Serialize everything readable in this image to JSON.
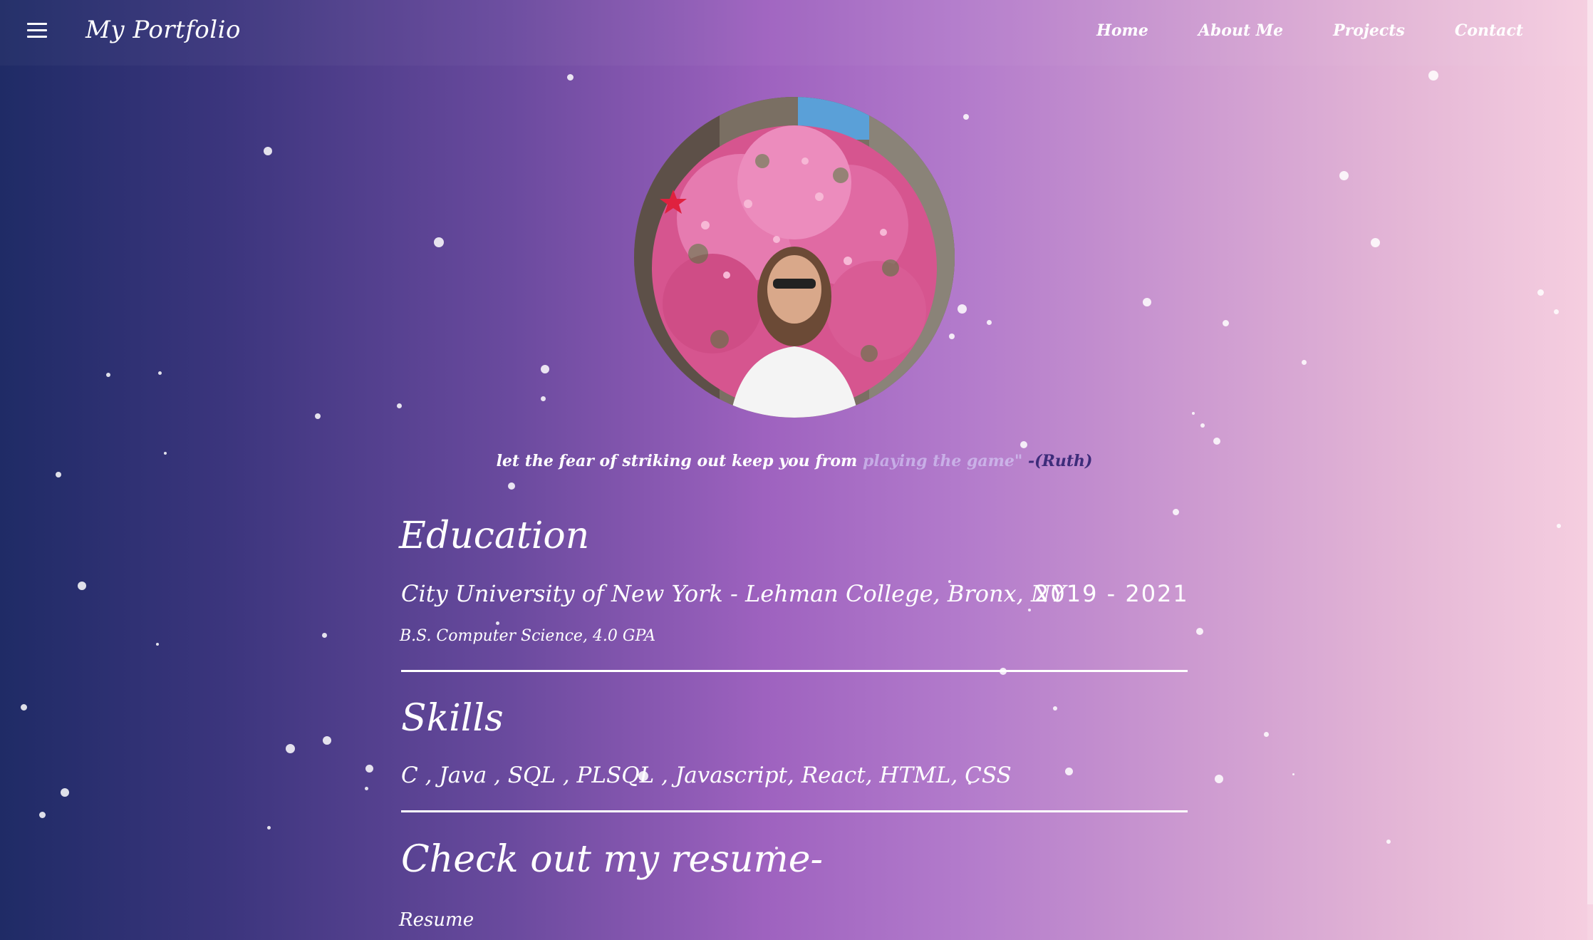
{
  "navbar": {
    "menu_icon": "hamburger-menu-icon",
    "brand": "My Portfolio",
    "links": [
      "Home",
      "About Me",
      "Projects",
      "Contact"
    ]
  },
  "hero": {
    "photo_alt": "Profile photo in front of a pink flower bush",
    "quote_part1": "let the fear of striking out keep you from ",
    "quote_part2": "playing the game\"",
    "quote_author": " -(Ruth)"
  },
  "education": {
    "title": "Education",
    "school": "City University of New York - Lehman College, Bronx, NY",
    "years": "2019 - 2021",
    "degree": "B.S. Computer Science, 4.0 GPA"
  },
  "skills": {
    "title": "Skills",
    "list": "C , Java , SQL , PLSQL , Javascript, React, HTML, CSS"
  },
  "resume": {
    "title": "Check out my resume-",
    "link_label": "Resume"
  },
  "colors": {
    "gradient_left": "#1f2b66",
    "gradient_mid": "#9e62bf",
    "gradient_right": "#f6cfe0",
    "quote_author": "#3d2c7a"
  }
}
